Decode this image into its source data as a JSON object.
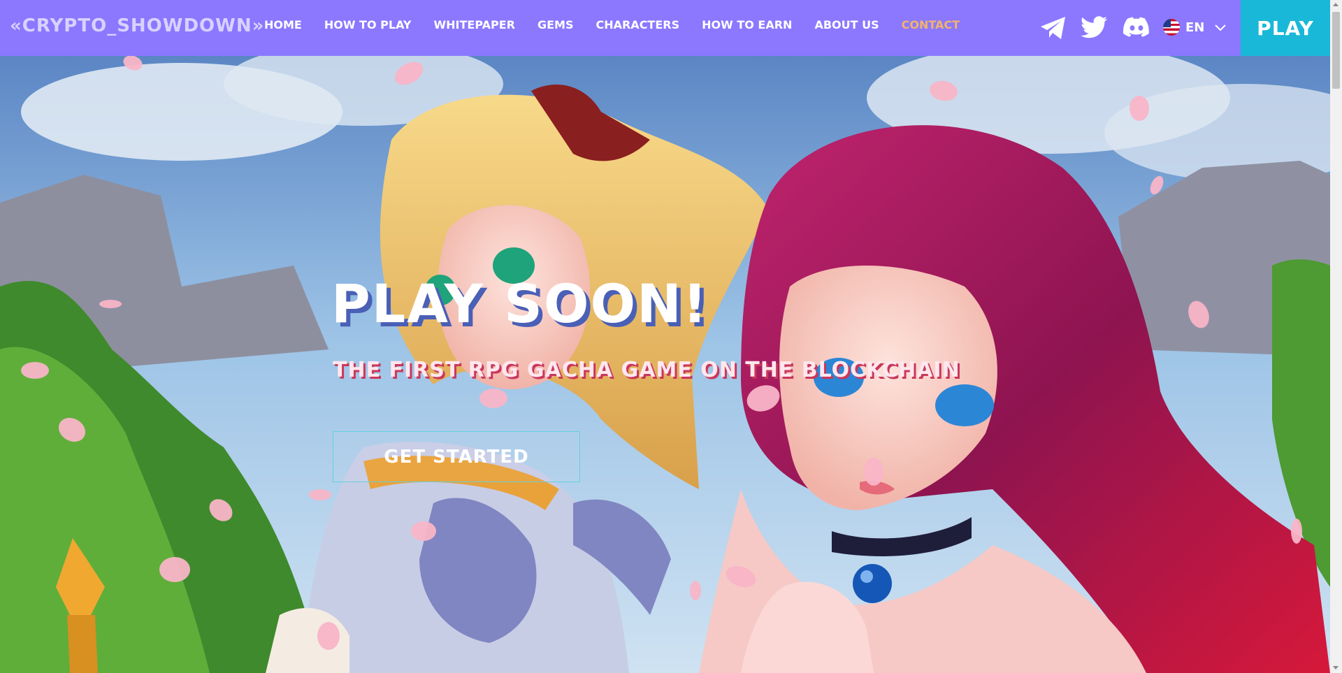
{
  "brand": {
    "logo_text": "«CRYPTO_SHOWDOWN»"
  },
  "nav": {
    "items": [
      {
        "label": "HOME"
      },
      {
        "label": "HOW TO PLAY"
      },
      {
        "label": "WHITEPAPER"
      },
      {
        "label": "GEMS"
      },
      {
        "label": "CHARACTERS"
      },
      {
        "label": "HOW TO EARN"
      },
      {
        "label": "ABOUT US"
      },
      {
        "label": "CONTACT",
        "active": true
      }
    ],
    "social": [
      "telegram-icon",
      "twitter-icon",
      "discord-icon"
    ],
    "language": {
      "code": "EN",
      "flag": "us-flag-icon"
    },
    "play_label": "PLAY"
  },
  "hero": {
    "title": "PLAY SOON!",
    "subtitle": "THE FIRST RPG GACHA GAME ON THE BLOCKCHAIN",
    "cta_label": "GET STARTED"
  },
  "colors": {
    "navbar": "#8b78ff",
    "active_link": "#f2b36b",
    "play_button": "#19b8d8",
    "cta_border": "#62d1dd"
  }
}
